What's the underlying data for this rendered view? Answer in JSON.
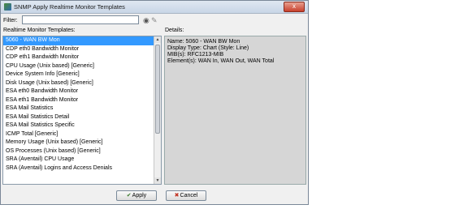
{
  "window": {
    "title": "SNMP Apply Realtime Monitor Templates",
    "close_label": "x"
  },
  "filter": {
    "label": "Filter:",
    "value": ""
  },
  "list": {
    "label": "Realtime Monitor Templates:",
    "items": [
      "5060 - WAN BW Mon",
      "CDP eth0 Bandwidth Monitor",
      "CDP eth1 Bandwidth Monitor",
      "CPU Usage (Unix based) [Generic]",
      "Device System Info [Generic]",
      "Disk Usage (Unix based) [Generic]",
      "ESA eth0 Bandwidth Monitor",
      "ESA eth1 Bandwidth Monitor",
      "ESA Mail Statistics",
      "ESA Mail Statistics Detail",
      "ESA Mail Statistics Specific",
      "ICMP Total [Generic]",
      "Memory Usage (Unix based) [Generic]",
      "OS Processes (Unix based) [Generic]",
      "SRA (Aventail) CPU Usage",
      "SRA (Aventail) Logins and Access Denials"
    ],
    "selected_index": 0
  },
  "details": {
    "label": "Details:",
    "lines": [
      "Name: 5060 - WAN BW Mon",
      "Display Type: Chart   (Style: Line)",
      "MIB(s): RFC1213-MIB",
      "Element(s): WAN In, WAN Out, WAN Total"
    ]
  },
  "buttons": {
    "apply_label": "Apply",
    "cancel_label": "Cancel"
  },
  "icons": {
    "app": "app-icon",
    "filter_search": "binoculars-icon",
    "filter_clear": "eraser-icon",
    "apply": "check-icon",
    "cancel": "x-icon"
  },
  "colors": {
    "selection": "#3399ff",
    "details_bg": "#d6d6d6"
  }
}
